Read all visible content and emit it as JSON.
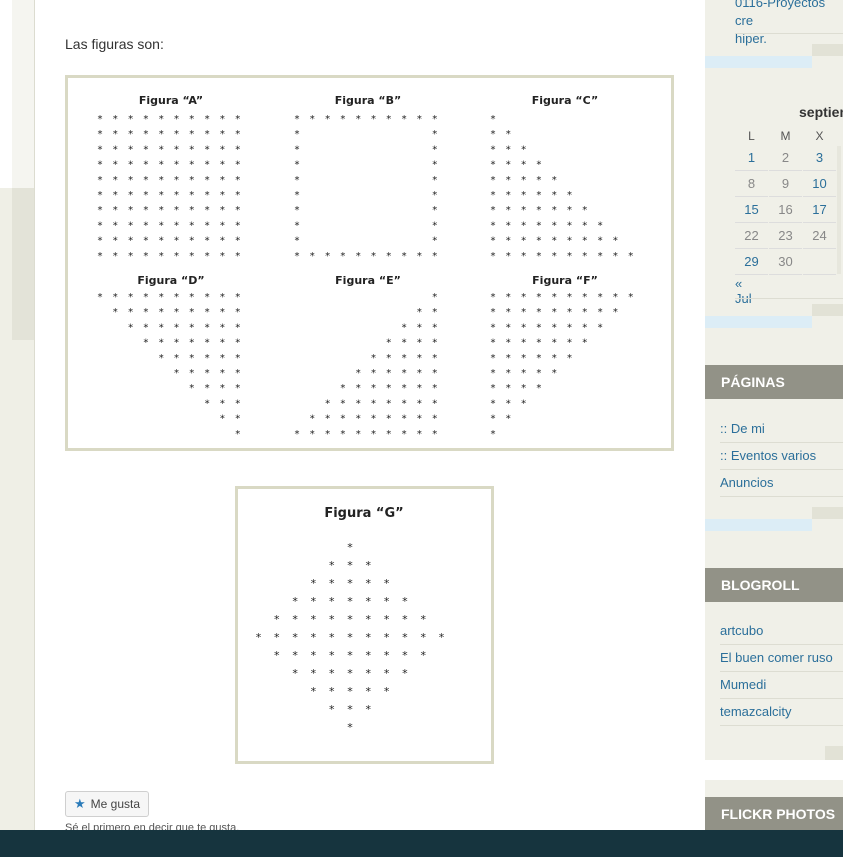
{
  "main": {
    "intro_text": "Las figuras son:",
    "figures": {
      "a_title": "Figura “A”",
      "b_title": "Figura “B”",
      "c_title": "Figura “C”",
      "d_title": "Figura “D”",
      "e_title": "Figura “E”",
      "f_title": "Figura “F”",
      "g_title": "Figura “G”"
    },
    "like_button": "Me gusta",
    "like_note": "Sé el primero en decir que te gusta."
  },
  "sidebar": {
    "top_link_line1": "0116-Proyectos cre",
    "top_link_line2": "hiper.",
    "calendar": {
      "month": "septiem",
      "weekdays": [
        "L",
        "M",
        "X"
      ],
      "rows": [
        [
          "1",
          "2",
          "3"
        ],
        [
          "8",
          "9",
          "10"
        ],
        [
          "15",
          "16",
          "17"
        ],
        [
          "22",
          "23",
          "24"
        ],
        [
          "29",
          "30",
          ""
        ]
      ],
      "prev_link": "« Jul"
    },
    "paginas": {
      "title": "PÁGINAS",
      "items": [
        ":: De mi",
        ":: Eventos varios",
        "Anuncios"
      ]
    },
    "blogroll": {
      "title": "BLOGROLL",
      "items": [
        "artcubo",
        "El buen comer ruso",
        "Mumedi",
        "temazcalcity"
      ]
    },
    "flickr": {
      "title": "FLICKR PHOTOS"
    }
  }
}
